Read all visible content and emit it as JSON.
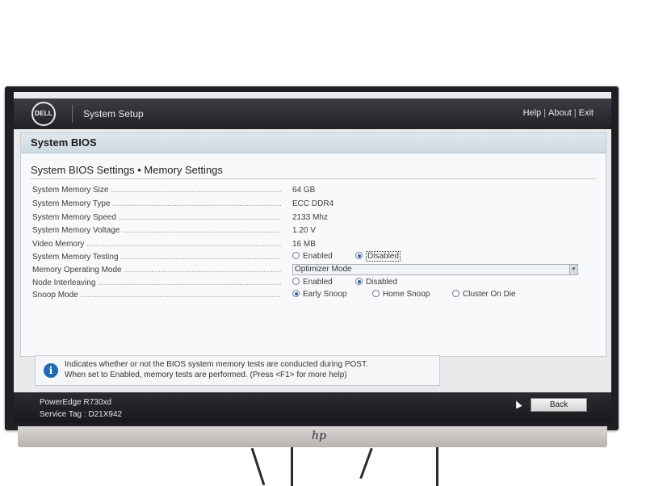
{
  "header": {
    "logo_text": "DELL",
    "app_title": "System Setup",
    "links": {
      "help": "Help",
      "about": "About",
      "exit": "Exit",
      "separator": "|"
    }
  },
  "section": {
    "title": "System BIOS"
  },
  "page": {
    "title": "System BIOS Settings • Memory Settings"
  },
  "settings": {
    "memory_size": {
      "label": "System Memory Size",
      "value": "64 GB"
    },
    "memory_type": {
      "label": "System Memory Type",
      "value": "ECC DDR4"
    },
    "memory_speed": {
      "label": "System Memory Speed",
      "value": "2133 Mhz"
    },
    "memory_voltage": {
      "label": "System Memory Voltage",
      "value": "1.20 V"
    },
    "video_memory": {
      "label": "Video Memory",
      "value": "16 MB"
    },
    "memory_testing": {
      "label": "System Memory Testing",
      "options": [
        "Enabled",
        "Disabled"
      ],
      "selected": "Disabled"
    },
    "operating_mode": {
      "label": "Memory Operating Mode",
      "value": "Optimizer Mode"
    },
    "node_interleaving": {
      "label": "Node Interleaving",
      "options": [
        "Enabled",
        "Disabled"
      ],
      "selected": "Disabled"
    },
    "snoop_mode": {
      "label": "Snoop Mode",
      "options": [
        "Early Snoop",
        "Home Snoop",
        "Cluster On Die"
      ],
      "selected": "Early Snoop"
    }
  },
  "help": {
    "line1": "Indicates whether or not the BIOS system memory tests are conducted during POST.",
    "line2": "When set to Enabled, memory tests are performed. (Press <F1> for more help)"
  },
  "footer": {
    "model": "PowerEdge R730xd",
    "service_tag": "Service Tag : D21X942",
    "back_label": "Back"
  },
  "monitor": {
    "brand": "hp"
  },
  "colors": {
    "header_bg": "#2b2d32",
    "accent_blue": "#1b6ab3",
    "section_bg": "#d8e1e9"
  }
}
